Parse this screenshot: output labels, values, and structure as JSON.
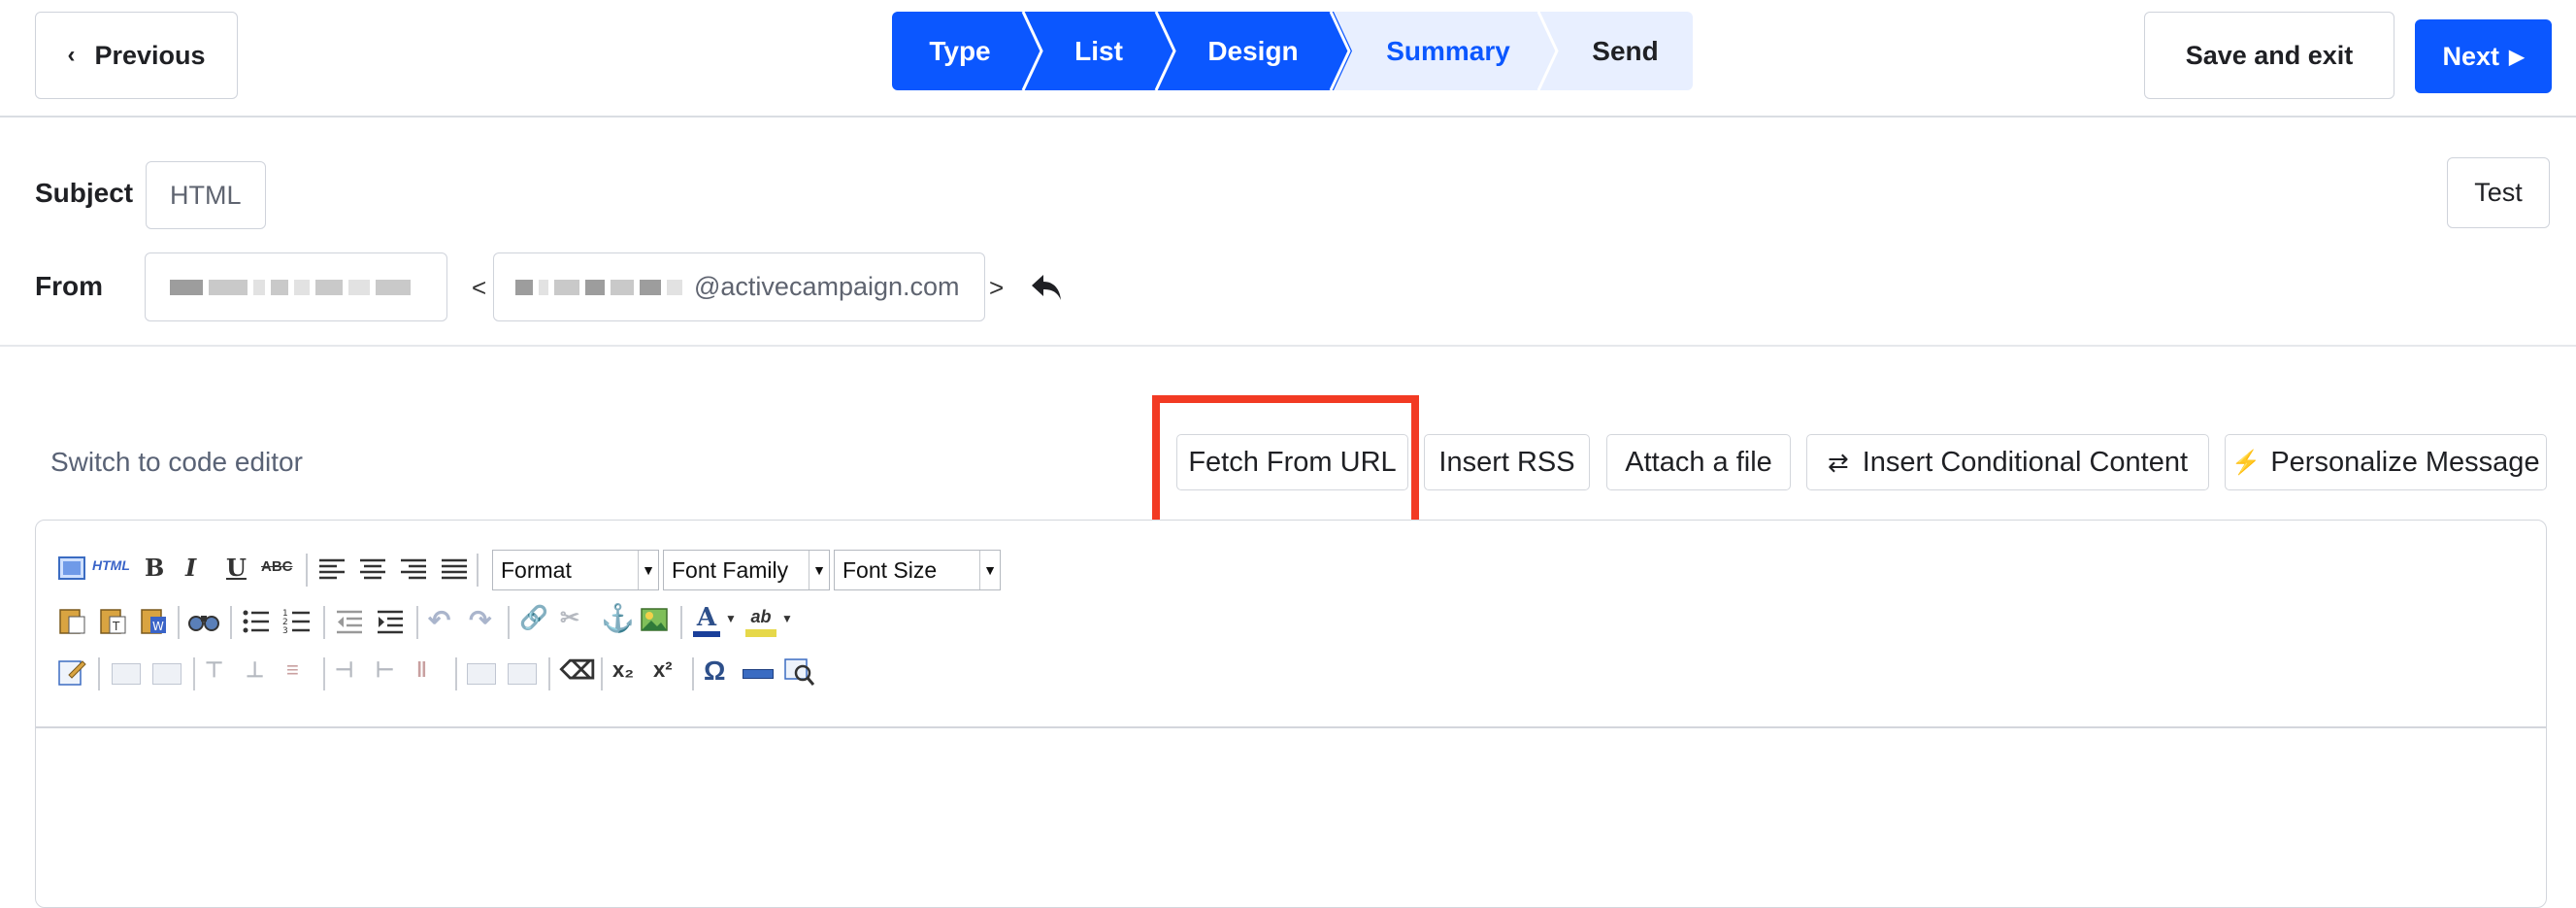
{
  "header": {
    "previous_label": "Previous",
    "previous_icon": "chevron-left-icon",
    "steps": [
      {
        "label": "Type",
        "state": "done"
      },
      {
        "label": "List",
        "state": "done"
      },
      {
        "label": "Design",
        "state": "done"
      },
      {
        "label": "Summary",
        "state": "current"
      },
      {
        "label": "Send",
        "state": "upcoming"
      }
    ],
    "save_exit_label": "Save and exit",
    "next_label": "Next",
    "next_icon": "caret-right-icon"
  },
  "form": {
    "subject_label": "Subject",
    "subject_value": "HTML",
    "test_label": "Test",
    "from_label": "From",
    "from_email_domain": "@activecampaign.com",
    "lt": "<",
    "gt": ">",
    "reply_icon": "reply-arrow-icon"
  },
  "editor_bar": {
    "switch_label": "Switch to code editor",
    "fetch_label": "Fetch From URL",
    "rss_label": "Insert RSS",
    "attach_label": "Attach a file",
    "conditional_label": "Insert Conditional Content",
    "conditional_icon": "swap-arrows-icon",
    "personalize_label": "Personalize Message",
    "personalize_icon": "lightning-icon"
  },
  "wysiwyg": {
    "format_label": "Format",
    "font_family_label": "Font Family",
    "font_size_label": "Font Size",
    "html_label": "HTML",
    "bold": "B",
    "italic": "I",
    "underline": "U",
    "strike": "ABC",
    "font_color": "A",
    "bg_color": "ab",
    "subscript": "x₂",
    "superscript": "x²",
    "omega": "Ω"
  },
  "colors": {
    "accent": "#0b57ff",
    "step_inactive": "#e8efff",
    "highlight": "#f23a23"
  }
}
